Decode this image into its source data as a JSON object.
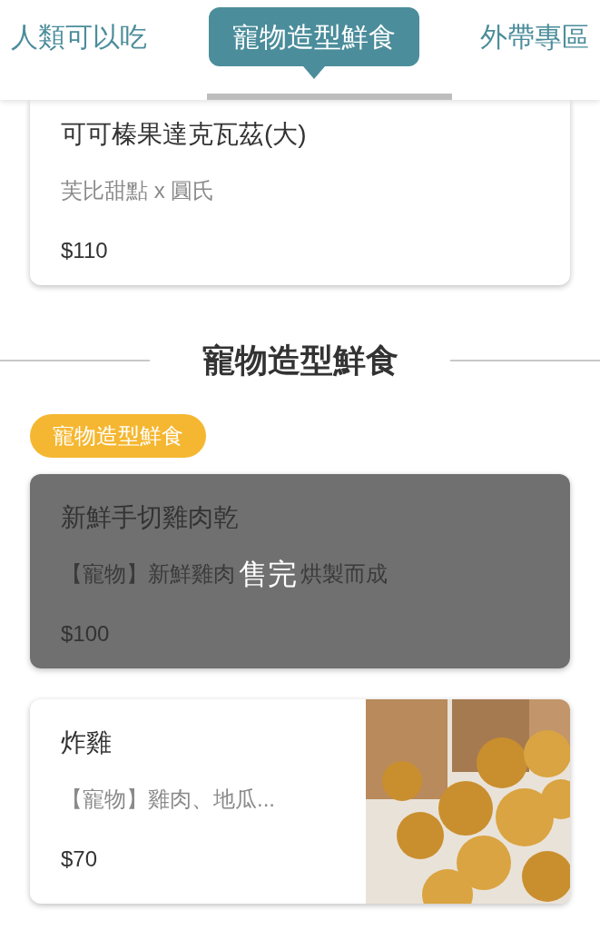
{
  "tabs": [
    {
      "label": "人類可以吃",
      "selected": false
    },
    {
      "label": "寵物造型鮮食",
      "selected": true
    },
    {
      "label": "外帶專區",
      "selected": false
    }
  ],
  "items_before": [
    {
      "name": "可可榛果達克瓦茲(大)",
      "description": "芙比甜點 x 圓氏",
      "price": "$110",
      "sold_out": false
    }
  ],
  "section": {
    "title": "寵物造型鮮食",
    "tag": "寵物造型鮮食",
    "items": [
      {
        "name": "新鮮手切雞肉乾",
        "description_parts": [
          "【寵物】新鮮雞肉",
          "烘製而成"
        ],
        "price": "$100",
        "sold_out": true,
        "sold_out_label": "售完"
      },
      {
        "name": "炸雞",
        "description": "【寵物】雞肉、地瓜...",
        "price": "$70",
        "sold_out": false
      }
    ]
  }
}
